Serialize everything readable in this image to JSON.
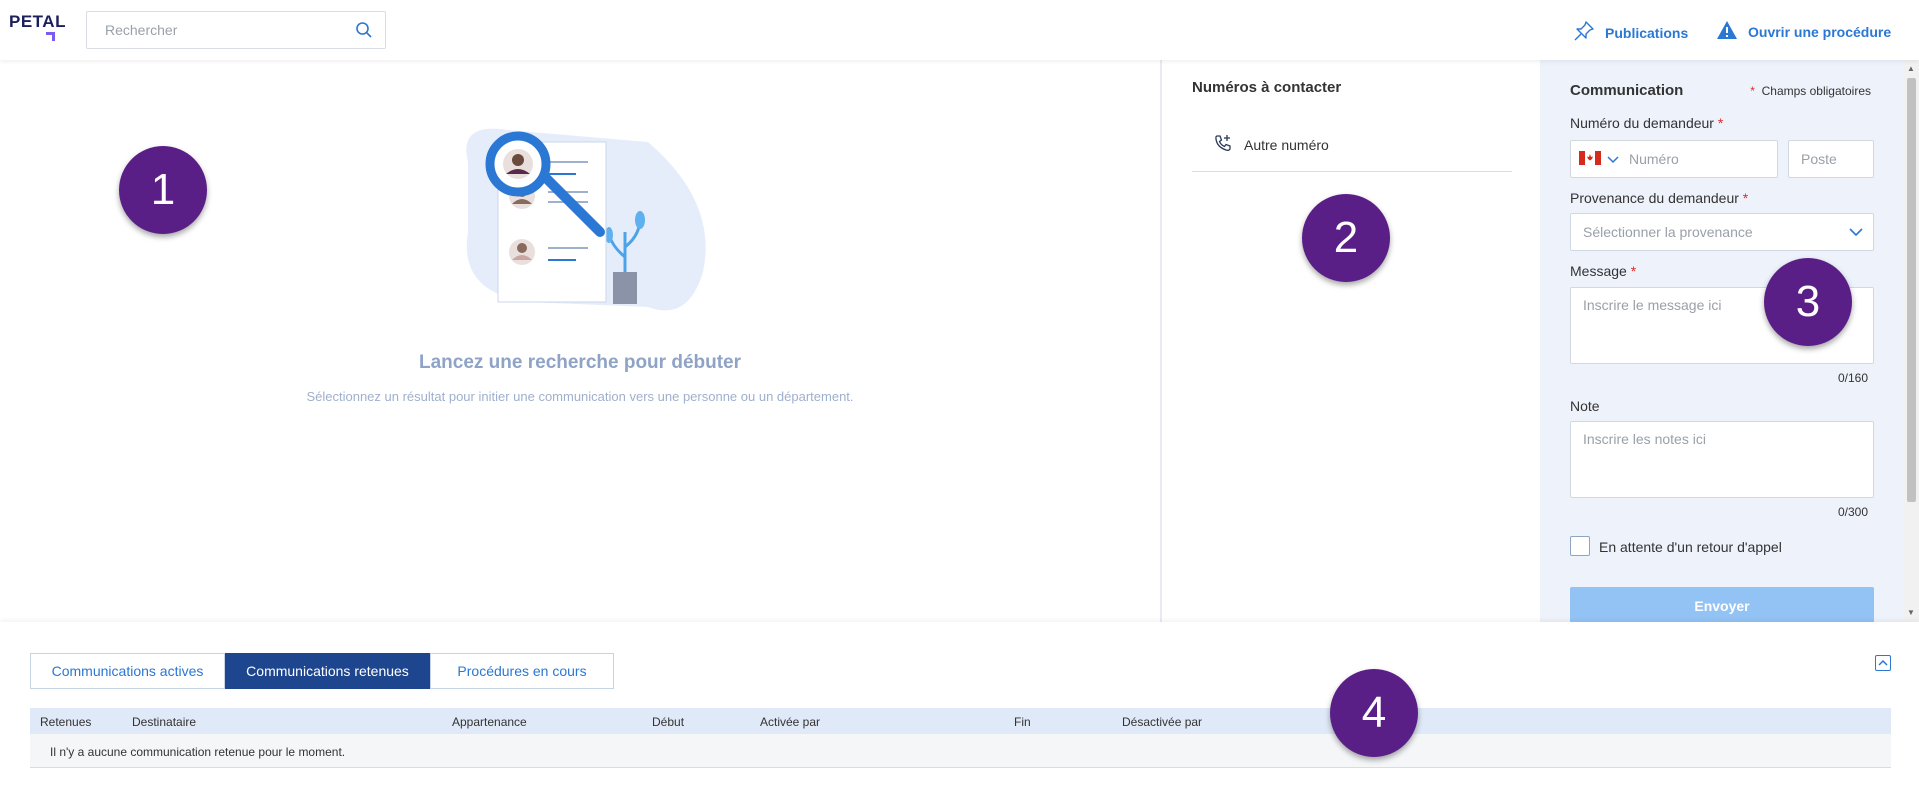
{
  "app": {
    "logo": "PETAL"
  },
  "search": {
    "placeholder": "Rechercher"
  },
  "topnav": {
    "publications": "Publications",
    "open_procedure": "Ouvrir une procédure"
  },
  "main": {
    "empty_title": "Lancez une recherche pour débuter",
    "empty_subtitle": "Sélectionnez un résultat pour initier une communication vers une personne ou un département."
  },
  "contacts": {
    "title": "Numéros à contacter",
    "other_number": "Autre numéro"
  },
  "communication": {
    "title": "Communication",
    "required_note": "Champs obligatoires",
    "requester_number_label": "Numéro du demandeur",
    "number_placeholder": "Numéro",
    "extension_placeholder": "Poste",
    "origin_label": "Provenance du demandeur",
    "origin_placeholder": "Sélectionner la provenance",
    "message_label": "Message",
    "message_placeholder": "Inscrire le message ici",
    "message_counter": "0/160",
    "note_label": "Note",
    "note_placeholder": "Inscrire les notes ici",
    "note_counter": "0/300",
    "callback_label": "En attente d'un retour d'appel",
    "send_label": "Envoyer"
  },
  "bottom": {
    "tabs": [
      {
        "label": "Communications actives",
        "active": false
      },
      {
        "label": "Communications retenues",
        "active": true
      },
      {
        "label": "Procédures en cours",
        "active": false
      }
    ],
    "columns": [
      "Retenues",
      "Destinataire",
      "Appartenance",
      "Début",
      "Activée par",
      "Fin",
      "Désactivée par"
    ],
    "empty_message": "Il n'y a aucune communication retenue pour le moment."
  },
  "badges": [
    "1",
    "2",
    "3",
    "4"
  ],
  "colors": {
    "accent": "#2a77d4",
    "active_tab": "#1e468f",
    "badge": "#5a1f86",
    "form_bg": "#edf2fb",
    "send_button": "#92c3f4"
  }
}
